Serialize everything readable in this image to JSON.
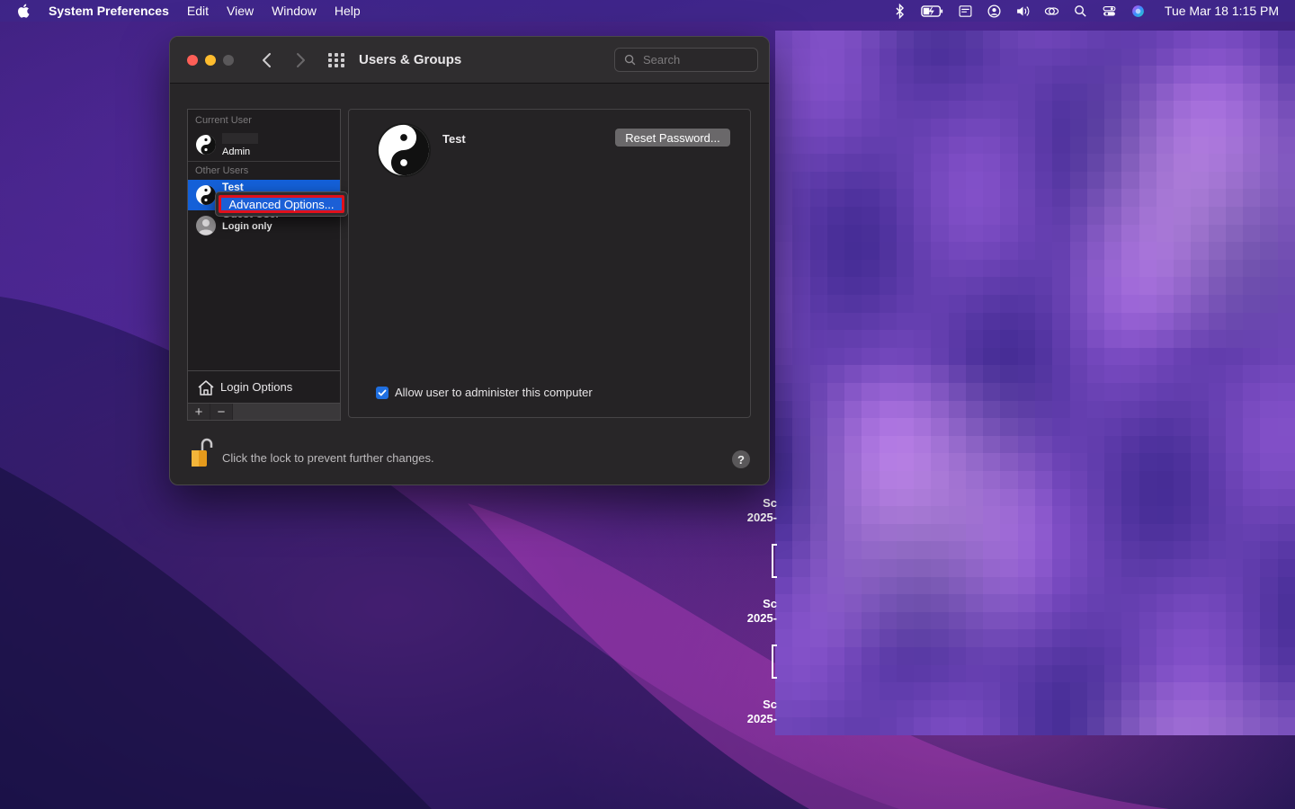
{
  "menubar": {
    "app_name": "System Preferences",
    "items": [
      "Edit",
      "View",
      "Window",
      "Help"
    ],
    "clock": "Tue Mar 18  1:15 PM"
  },
  "window": {
    "title": "Users & Groups",
    "search_placeholder": "Search"
  },
  "userlist": {
    "current_user_header": "Current User",
    "current_user_role": "Admin",
    "other_users_header": "Other Users",
    "selected_user_name": "Test",
    "guest_user_name": "Guest User",
    "guest_user_role": "Login only",
    "login_options_label": "Login Options",
    "add_label": "+",
    "remove_label": "−"
  },
  "context_menu": {
    "item_label": "Advanced Options..."
  },
  "detail": {
    "user_name": "Test",
    "reset_password_label": "Reset Password...",
    "admin_checkbox_label": "Allow user to administer this computer",
    "admin_checked": true
  },
  "footer": {
    "lock_text": "Click the lock to prevent further changes.",
    "help_label": "?"
  },
  "desktop": {
    "file_labels": [
      {
        "line1": "Sc",
        "line2": "2025-"
      },
      {
        "line1": "Sc",
        "line2": "2025-"
      },
      {
        "line1": "Sc",
        "line2": "2025-"
      }
    ]
  },
  "colors": {
    "selection_blue": "#1460d8",
    "highlight_red": "#e0101c",
    "close": "#fe5f57",
    "minimize": "#febc2e"
  }
}
